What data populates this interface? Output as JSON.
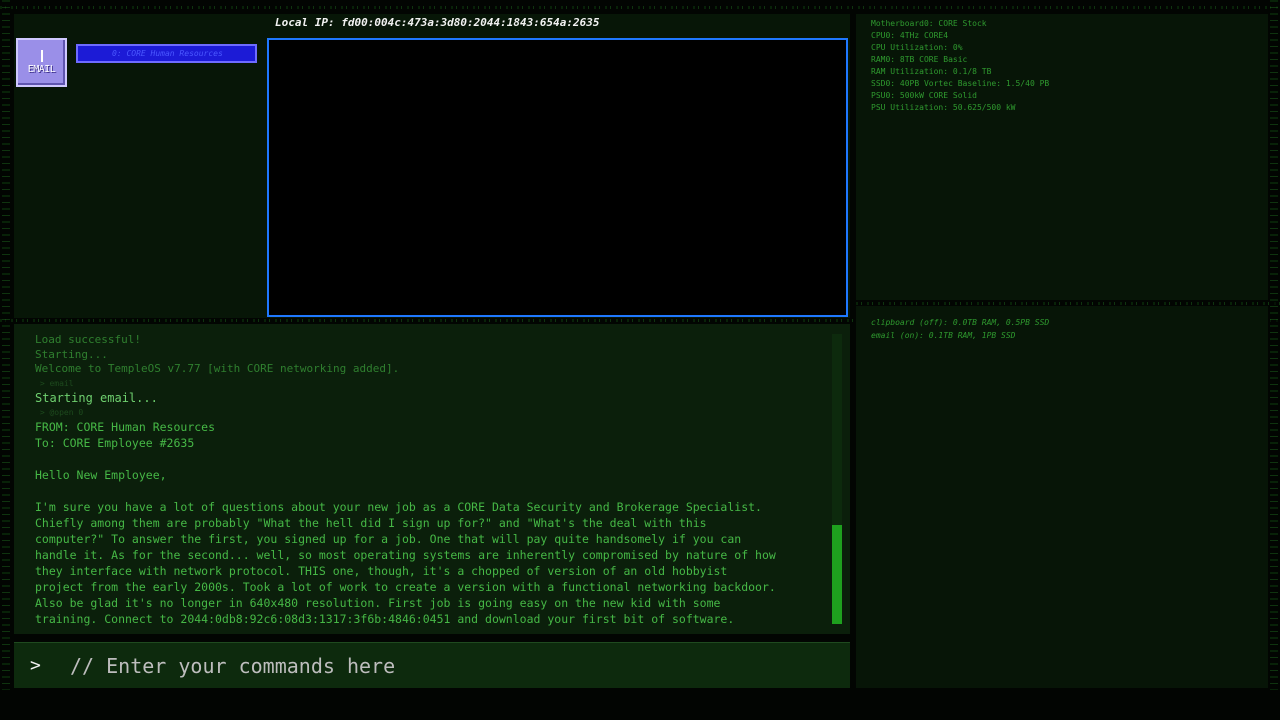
{
  "header": {
    "local_ip": "Local IP: fd00:004c:473a:3d80:2044:1843:654a:2635"
  },
  "desktop": {
    "email_icon": {
      "label": "EMAIL",
      "icon": "email-icon"
    },
    "email_tab": {
      "label": "0: CORE Human Resources"
    }
  },
  "stats": [
    "Motherboard0: CORE Stock",
    "CPU0: 4THz CORE4",
    "CPU Utilization: 0%",
    "RAM0: 8TB CORE Basic",
    "RAM Utilization: 0.1/8 TB",
    "SSD0: 40PB Vortec Baseline: 1.5/40 PB",
    "PSU0: 500kW CORE Solid",
    "PSU Utilization: 50.625/500 kW"
  ],
  "processes": [
    "clipboard (off): 0.0TB RAM, 0.5PB SSD",
    "email (on): 0.1TB RAM, 1PB SSD"
  ],
  "terminal": {
    "lines": [
      {
        "text": "Load successful!",
        "style": "dim"
      },
      {
        "text": "Starting...",
        "style": "dim"
      },
      {
        "text": "Welcome to TempleOS v7.77 [with CORE networking added].",
        "style": "dim"
      },
      {
        "text": " > email",
        "style": "faint"
      },
      {
        "text": "Starting email...",
        "style": "bright"
      },
      {
        "text": " > @open 0",
        "style": "faint"
      },
      {
        "text": "FROM: CORE Human Resources",
        "style": "body"
      },
      {
        "text": "To: CORE Employee #2635",
        "style": "body"
      },
      {
        "text": "",
        "style": "gap"
      },
      {
        "text": "Hello New Employee,",
        "style": "body"
      },
      {
        "text": "",
        "style": "gap"
      },
      {
        "text": "I'm sure you have a lot of questions about your new job as a CORE Data Security and Brokerage Specialist.",
        "style": "body"
      },
      {
        "text": "Chiefly among them are probably \"What the hell did I sign up for?\" and \"What's the deal with this",
        "style": "body"
      },
      {
        "text": "computer?\" To answer the first, you signed up for a job. One that will pay quite handsomely if you can",
        "style": "body"
      },
      {
        "text": "handle it. As for the second... well, so most operating systems are inherently compromised by nature of how",
        "style": "body"
      },
      {
        "text": "they interface with network protocol. THIS one, though, it's a chopped of version of an old hobbyist",
        "style": "body"
      },
      {
        "text": "project from the early 2000s. Took a lot of work to create a version with a functional networking backdoor.",
        "style": "body"
      },
      {
        "text": "Also be glad it's no longer in 640x480 resolution. First job is going easy on the new kid with some",
        "style": "body"
      },
      {
        "text": "training. Connect to 2044:0db8:92c6:08d3:1317:3f6b:4846:0451 and download your first bit of software.",
        "style": "body"
      }
    ],
    "scroll": {
      "thumb_start": 0.66,
      "thumb_end": 1.0
    }
  },
  "command": {
    "prompt": ">",
    "placeholder": "// Enter your commands here"
  },
  "colors": {
    "background": "#020502",
    "terminal_text": "#46b846",
    "window_border": "#1f78ff",
    "tab_fill": "#1c1bd6",
    "icon_fill": "#9a8fe8",
    "scroll_thumb": "#1ea01e"
  }
}
